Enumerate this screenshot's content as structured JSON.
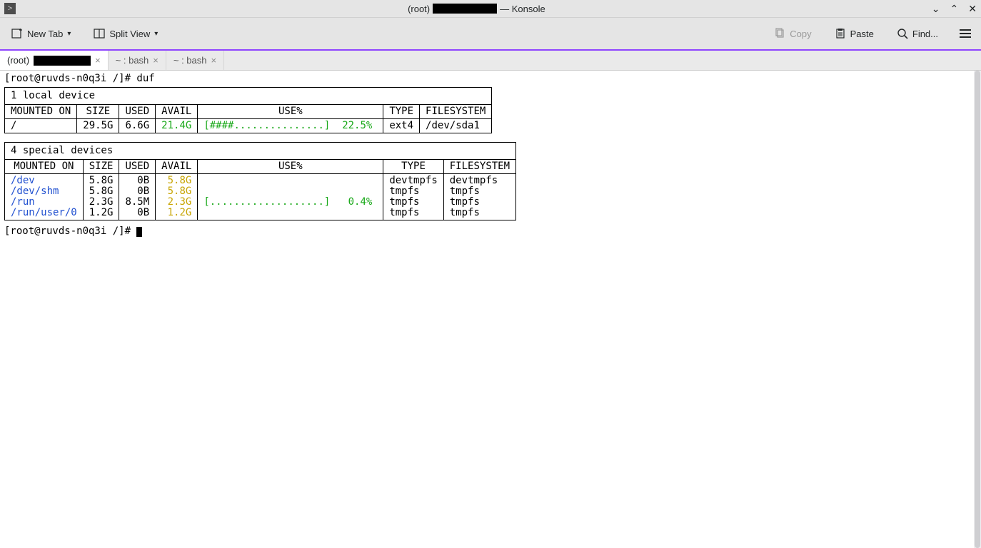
{
  "window": {
    "title_prefix": "(root)",
    "title_suffix": "— Konsole"
  },
  "toolbar": {
    "new_tab": "New Tab",
    "split_view": "Split View",
    "copy": "Copy",
    "paste": "Paste",
    "find": "Find..."
  },
  "tabs": [
    {
      "label_prefix": "(root)",
      "active": true,
      "redacted": true
    },
    {
      "label": "~ : bash",
      "active": false
    },
    {
      "label": "~ : bash",
      "active": false
    }
  ],
  "prompt1": "[root@ruvds-n0q3i /]# duf",
  "prompt2": "[root@ruvds-n0q3i /]# ",
  "local": {
    "caption": "1 local device",
    "headers": [
      "MOUNTED ON",
      "SIZE",
      "USED",
      "AVAIL",
      "USE%",
      "TYPE",
      "FILESYSTEM"
    ],
    "row": {
      "mounted": "/",
      "size": "29.5G",
      "used": "6.6G",
      "avail": "21.4G",
      "usebar": "[####...............]",
      "usepct": "22.5%",
      "type": "ext4",
      "fs": "/dev/sda1"
    }
  },
  "special": {
    "caption": "4 special devices",
    "headers": [
      "MOUNTED ON",
      "SIZE",
      "USED",
      "AVAIL",
      "USE%",
      "TYPE",
      "FILESYSTEM"
    ],
    "rows": [
      {
        "mounted": "/dev",
        "size": "5.8G",
        "used": "0B",
        "avail": "5.8G",
        "usebar": "",
        "usepct": "",
        "type": "devtmpfs",
        "fs": "devtmpfs"
      },
      {
        "mounted": "/dev/shm",
        "size": "5.8G",
        "used": "0B",
        "avail": "5.8G",
        "usebar": "",
        "usepct": "",
        "type": "tmpfs",
        "fs": "tmpfs"
      },
      {
        "mounted": "/run",
        "size": "2.3G",
        "used": "8.5M",
        "avail": "2.3G",
        "usebar": "[...................]",
        "usepct": "0.4%",
        "type": "tmpfs",
        "fs": "tmpfs"
      },
      {
        "mounted": "/run/user/0",
        "size": "1.2G",
        "used": "0B",
        "avail": "1.2G",
        "usebar": "",
        "usepct": "",
        "type": "tmpfs",
        "fs": "tmpfs"
      }
    ]
  }
}
